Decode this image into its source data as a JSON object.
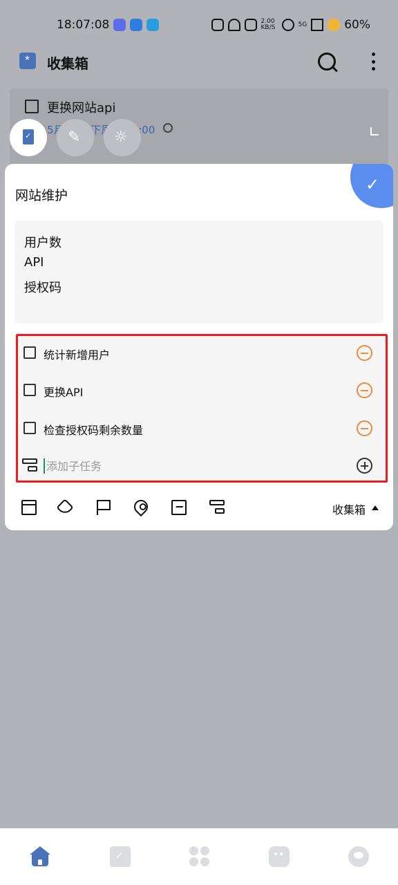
{
  "status_bar": {
    "time": "18:07:08",
    "speed": "2.00 KB/S",
    "network": "5G",
    "battery": "60%"
  },
  "header": {
    "title": "收集箱"
  },
  "background_task": {
    "title": "更换网站api",
    "date": "5月23日 下周二 10:00"
  },
  "sheet": {
    "title": "网站维护",
    "description": [
      "用户数",
      "API",
      "授权码"
    ],
    "subtasks": [
      {
        "label": "统计新增用户"
      },
      {
        "label": "更换API"
      },
      {
        "label": "检查授权码剩余数量"
      }
    ],
    "add_subtask_placeholder": "添加子任务",
    "project": "收集箱"
  },
  "colors": {
    "accent": "#4a72b8",
    "confirm": "#5b8def",
    "remove": "#f08a3c",
    "highlight_border": "#ee1c1c",
    "overlay": "#b1b3b8"
  },
  "icons": {
    "status": [
      "app-icon-1",
      "app-icon-2",
      "telegram-icon",
      "face-icon",
      "bell-mute-icon",
      "camera-icon",
      "wifi-icon",
      "signal-icon",
      "battery-icon"
    ],
    "toolbar": [
      "calendar-icon",
      "tag-icon",
      "flag-icon",
      "location-icon",
      "image-icon",
      "subtask-icon"
    ],
    "nav": [
      "home-icon",
      "calendar-check-icon",
      "grid-icon",
      "game-icon",
      "user-icon"
    ]
  }
}
